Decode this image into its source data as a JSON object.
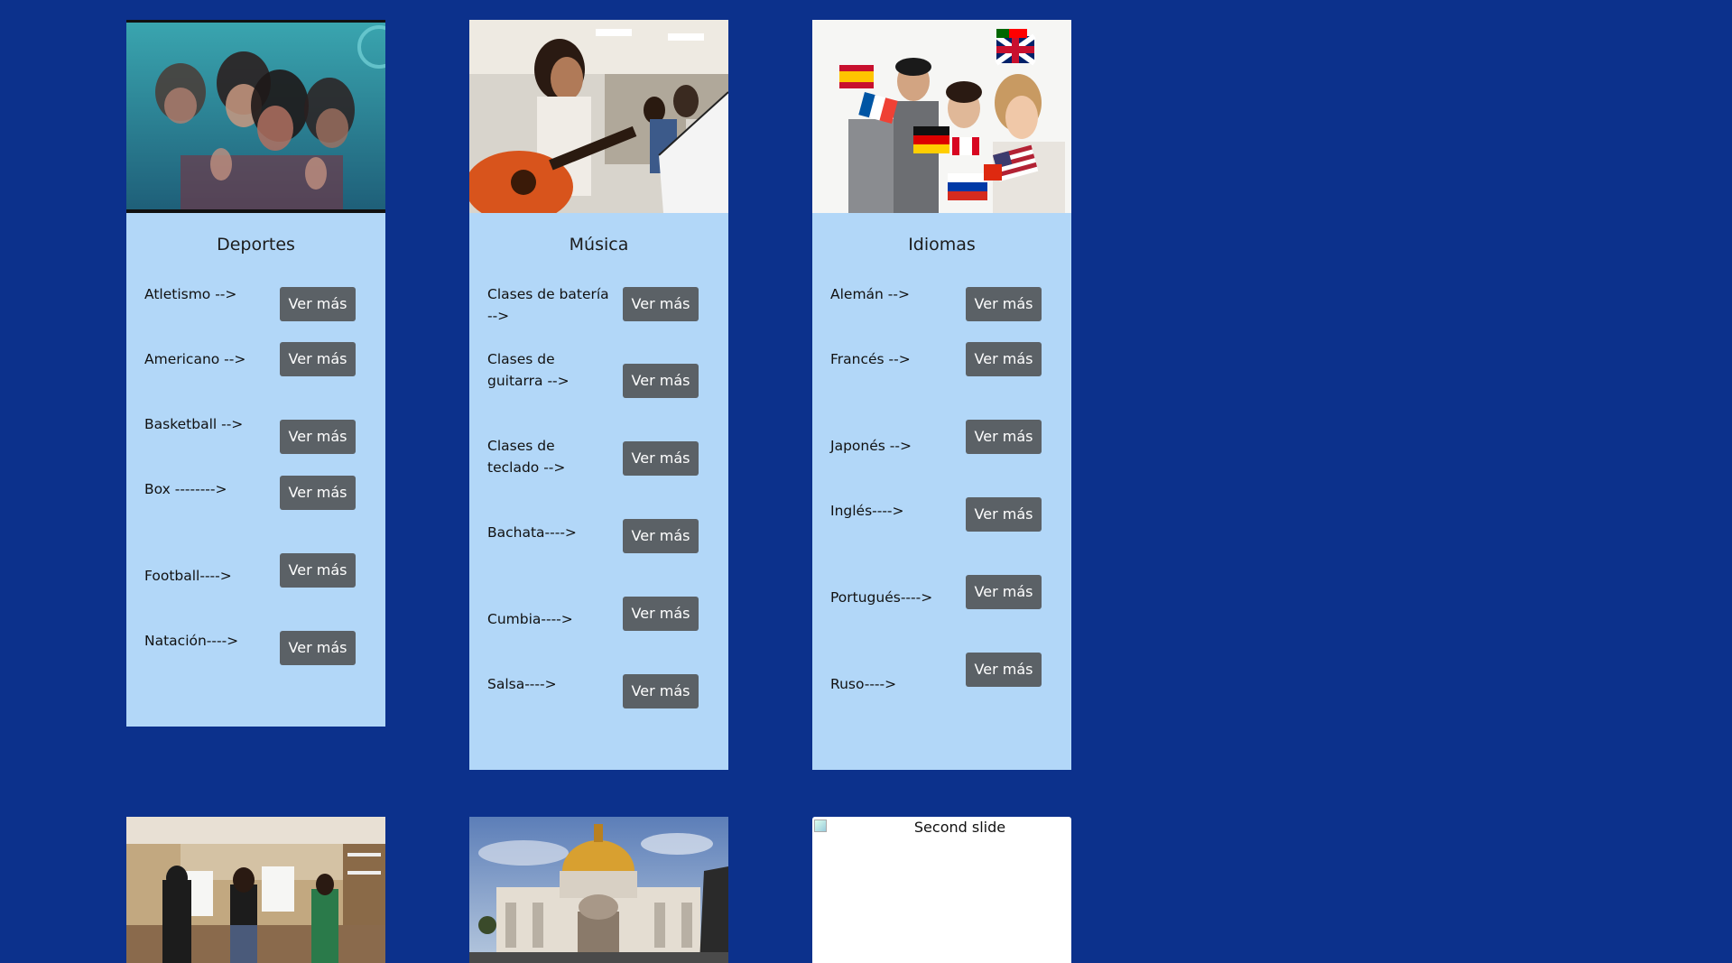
{
  "cards": [
    {
      "title": "Deportes",
      "image": "swimmers-underwater-photo",
      "items": [
        {
          "label": "Atletismo -->",
          "button": "Ver más"
        },
        {
          "label": "Americano -->",
          "button": "Ver más"
        },
        {
          "label": "Basketball -->",
          "button": "Ver más"
        },
        {
          "label": "Box -------->",
          "button": "Ver más"
        },
        {
          "label": "Football---->",
          "button": "Ver más"
        },
        {
          "label": "Natación---->",
          "button": "Ver más"
        }
      ]
    },
    {
      "title": "Música",
      "image": "girl-playing-guitar-photo",
      "items": [
        {
          "label": "Clases de batería -->",
          "button": "Ver más"
        },
        {
          "label": "Clases de guitarra -->",
          "button": "Ver más"
        },
        {
          "label": "Clases de teclado -->",
          "button": "Ver más"
        },
        {
          "label": "Bachata---->",
          "button": "Ver más"
        },
        {
          "label": "Cumbia---->",
          "button": "Ver más"
        },
        {
          "label": "Salsa---->",
          "button": "Ver más"
        }
      ]
    },
    {
      "title": "Idiomas",
      "image": "students-with-flags-photo",
      "items": [
        {
          "label": "Alemán -->",
          "button": "Ver más"
        },
        {
          "label": "Francés -->",
          "button": "Ver más"
        },
        {
          "label": "Japonés -->",
          "button": "Ver más"
        },
        {
          "label": "Inglés---->",
          "button": "Ver más"
        },
        {
          "label": "Portugués---->",
          "button": "Ver más"
        },
        {
          "label": "Ruso---->",
          "button": "Ver más"
        }
      ]
    }
  ],
  "bottom": [
    {
      "image": "art-class-easels-photo"
    },
    {
      "image": "palacio-bellas-artes-photo"
    },
    {
      "alt": "Second slide",
      "image": "broken-image-icon"
    }
  ],
  "colors": {
    "background": "#0c318c",
    "card": "#b2d7f8",
    "button": "#5b6166",
    "button_text": "#ffffff"
  }
}
